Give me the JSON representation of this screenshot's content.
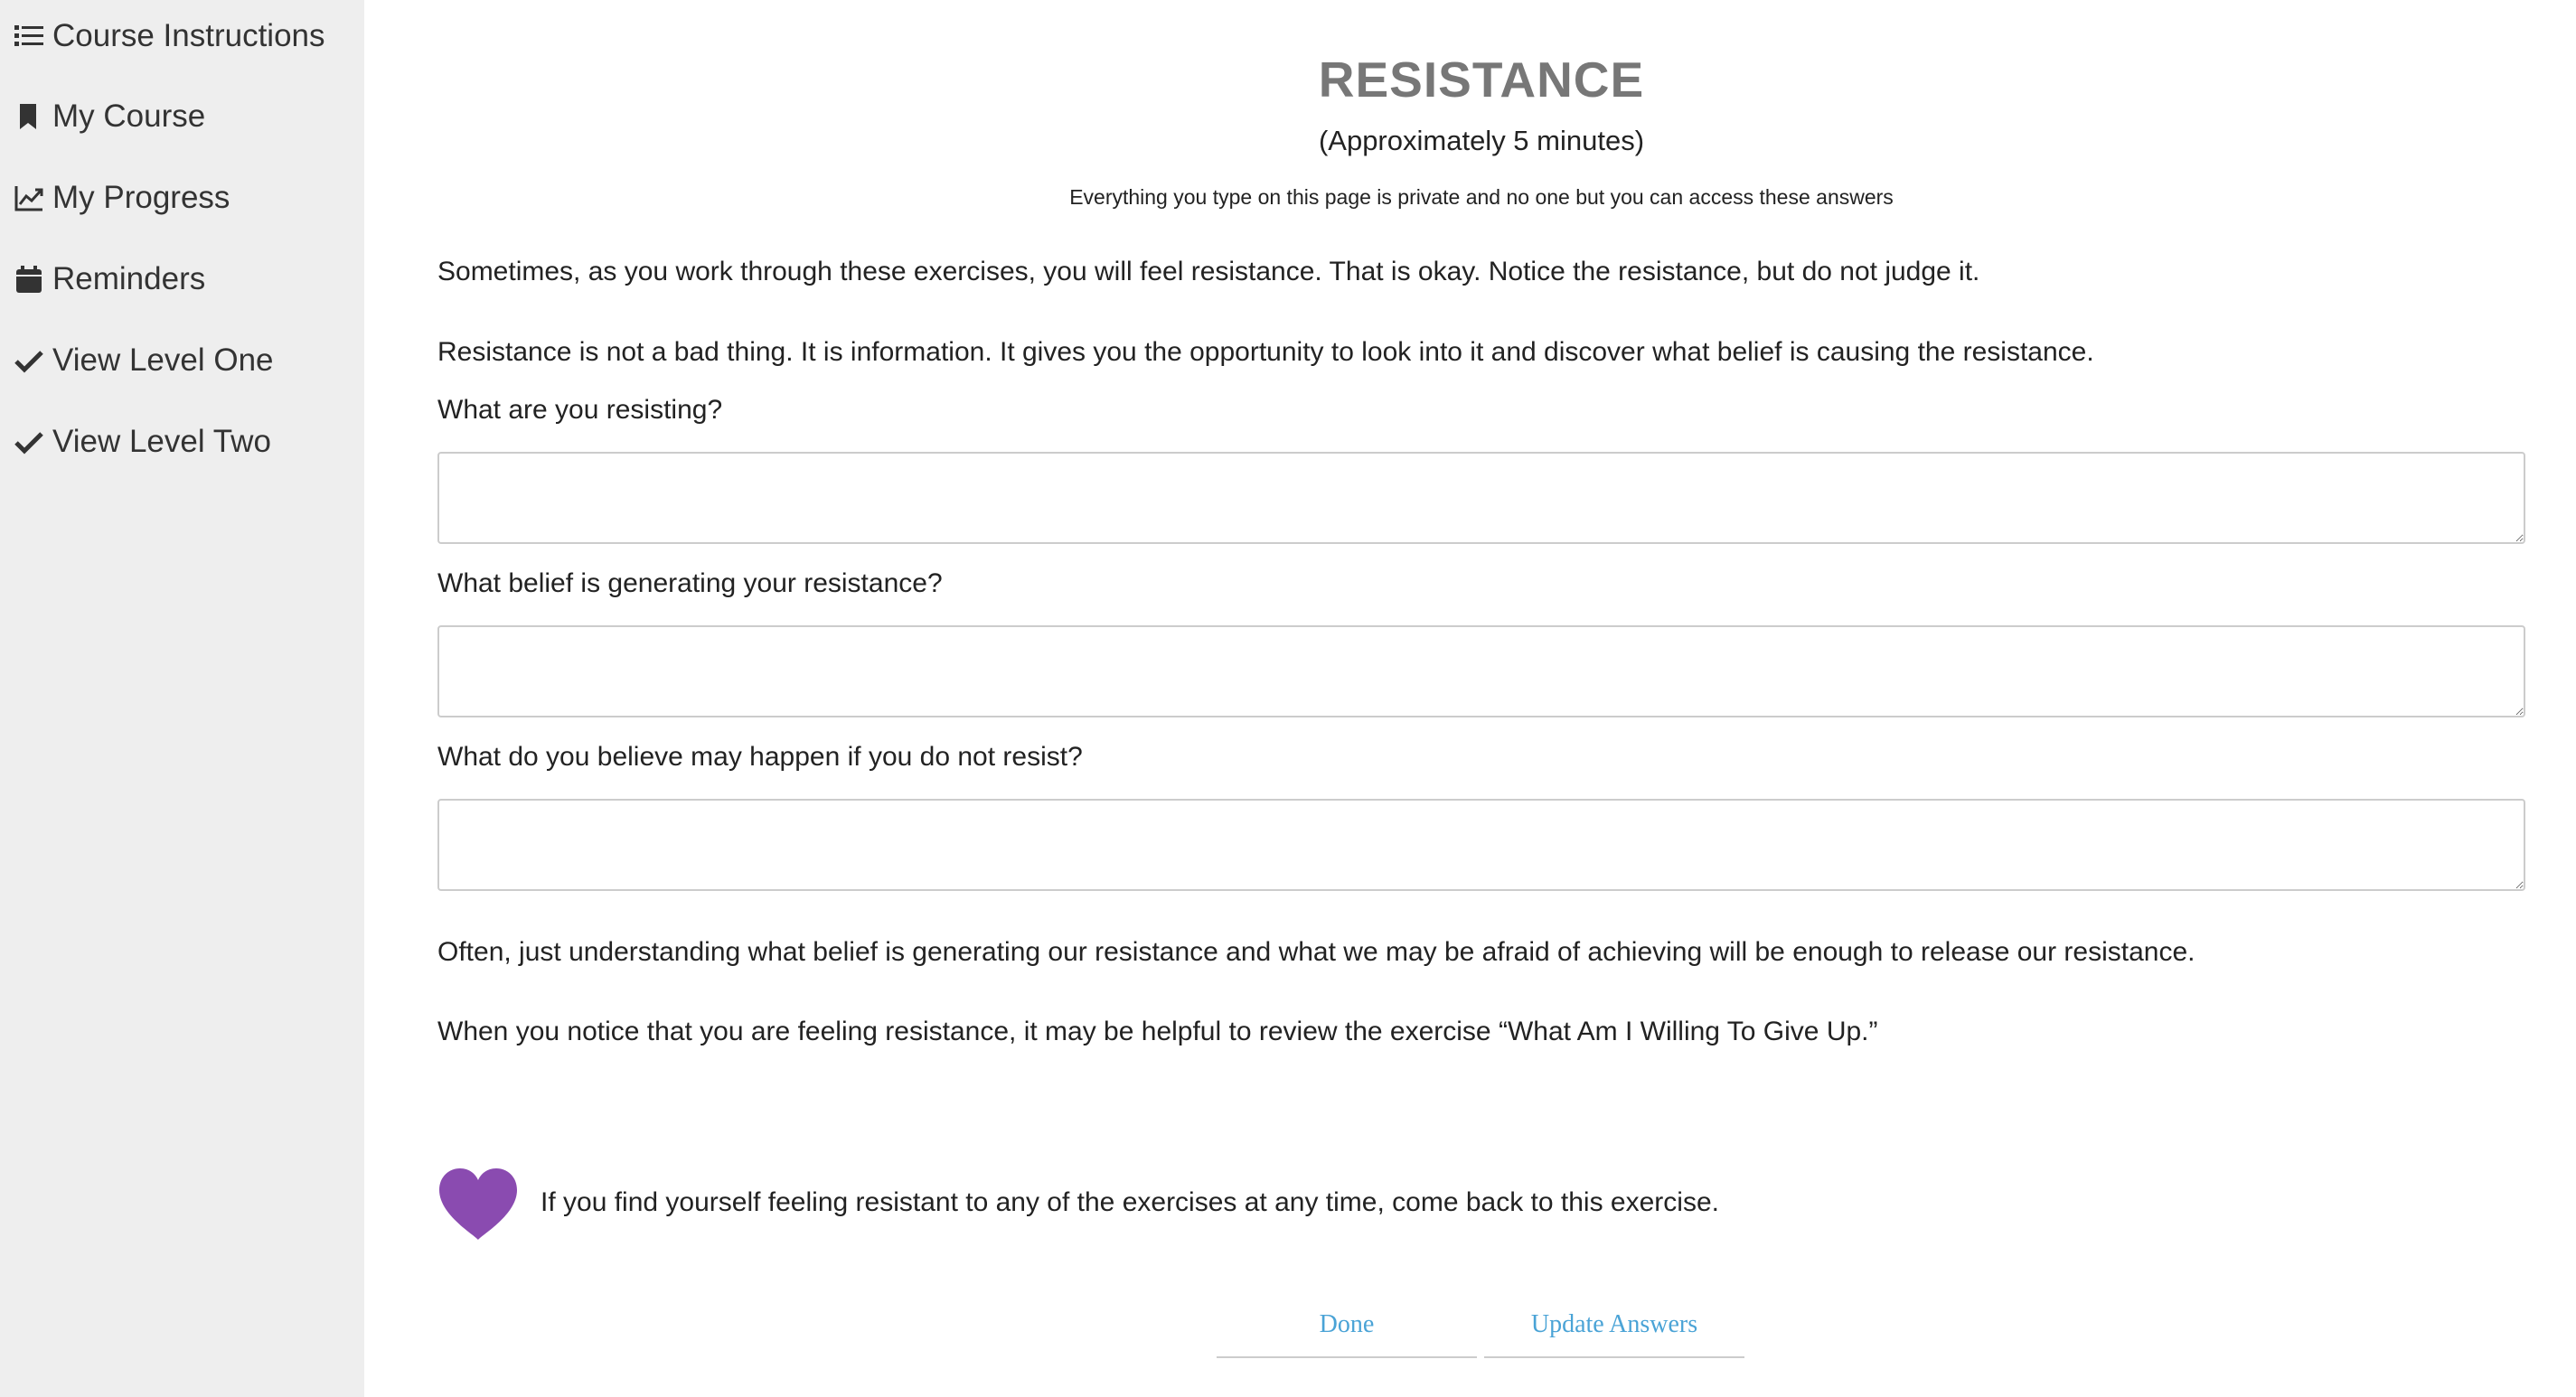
{
  "sidebar": {
    "items": [
      {
        "label": "Course Instructions",
        "icon": "list-icon"
      },
      {
        "label": "My Course",
        "icon": "bookmark-icon"
      },
      {
        "label": "My Progress",
        "icon": "line-chart-icon"
      },
      {
        "label": "Reminders",
        "icon": "calendar-icon"
      },
      {
        "label": "View Level One",
        "icon": "check-icon"
      },
      {
        "label": "View Level Two",
        "icon": "check-icon"
      }
    ]
  },
  "main": {
    "title": "RESISTANCE",
    "duration": "(Approximately 5 minutes)",
    "privacy_note": "Everything you type on this page is private and no one but you can access these answers",
    "intro_paragraphs": [
      "Sometimes, as you work through these exercises, you will feel resistance. That is okay. Notice the resistance, but do not judge it.",
      "Resistance is not a bad thing. It is information. It gives you the opportunity to look into it and discover what belief is causing the resistance."
    ],
    "questions": [
      {
        "label": "What are you resisting?",
        "value": ""
      },
      {
        "label": "What belief is generating your resistance?",
        "value": ""
      },
      {
        "label": "What do you believe may happen if you do not resist?",
        "value": ""
      }
    ],
    "closing_paragraphs": [
      "Often, just understanding what belief is generating our resistance and what we may be afraid of achieving will be enough to release our resistance.",
      "When you notice that you are feeling resistance, it may be helpful to review the exercise “What Am I Willing To Give Up.”"
    ],
    "callout": {
      "icon": "heart-icon",
      "text": "If you find yourself feeling resistant to any of the exercises at any time, come back to this exercise."
    },
    "buttons": {
      "done": "Done",
      "update": "Update Answers"
    }
  },
  "colors": {
    "sidebar_bg": "#eeeeee",
    "title": "#777777",
    "heart": "#8a4bb0",
    "button_text": "#4aa3d6"
  }
}
